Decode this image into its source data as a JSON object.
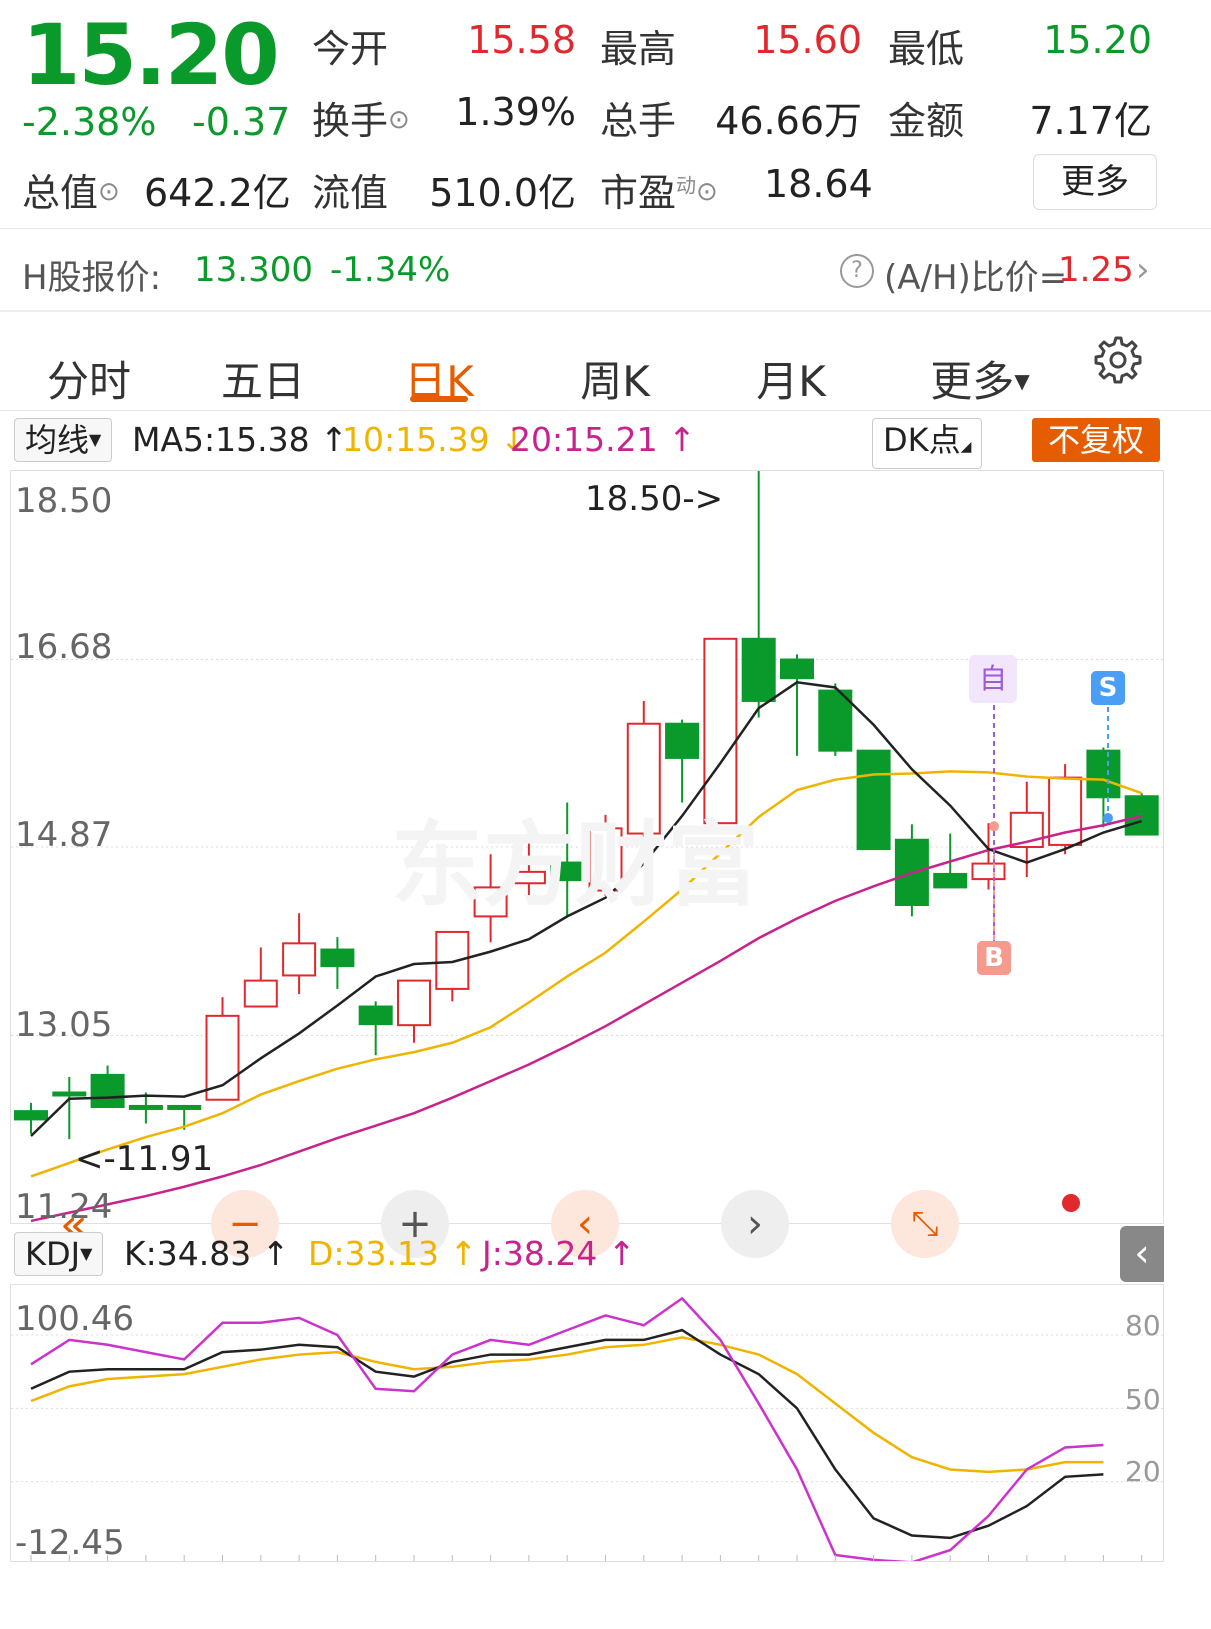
{
  "quote": {
    "price": "15.20",
    "change_pct": "-2.38%",
    "change": "-0.37",
    "rows": [
      [
        {
          "label": "今开",
          "value": "15.58",
          "color": "red"
        },
        {
          "label": "最高",
          "value": "15.60",
          "color": "red"
        },
        {
          "label": "最低",
          "value": "15.20",
          "color": "green"
        }
      ],
      [
        {
          "label": "换手",
          "value": "1.39%",
          "color": "dark"
        },
        {
          "label": "总手",
          "value": "46.66万",
          "color": "dark"
        },
        {
          "label": "金额",
          "value": "7.17亿",
          "color": "dark"
        }
      ]
    ],
    "total_value_label": "总值",
    "total_value": "642.2亿",
    "float_value_label": "流值",
    "float_value": "510.0亿",
    "pe_label": "市盈",
    "pe_superscript": "动",
    "pe_value": "18.64",
    "more_button": "更多"
  },
  "hshare": {
    "label": "H股报价:",
    "price": "13.300",
    "change_pct": "-1.34%",
    "ratio_label": "(A/H)比价=",
    "ratio_value": "1.25"
  },
  "tabs": [
    {
      "label": "分时",
      "active": false
    },
    {
      "label": "五日",
      "active": false
    },
    {
      "label": "日K",
      "active": true
    },
    {
      "label": "周K",
      "active": false
    },
    {
      "label": "月K",
      "active": false
    },
    {
      "label": "更多",
      "active": false
    }
  ],
  "ma_legend": {
    "dropdown": "均线",
    "ma5": "MA5:15.38",
    "ma10": "10:15.39",
    "ma20": "20:15.21",
    "dk_button": "DK点",
    "adjust_button": "不复权"
  },
  "price_chart": {
    "y_labels": [
      "18.50",
      "16.68",
      "14.87",
      "13.05",
      "11.24"
    ],
    "high_annotation": "18.50->",
    "low_annotation": "<-11.91",
    "watermark": "东方财富",
    "marker_self": "自",
    "marker_buy": "B",
    "marker_sell": "S"
  },
  "kdj_legend": {
    "dropdown": "KDJ",
    "k": "K:34.83",
    "d": "D:33.13",
    "j": "J:38.24"
  },
  "kdj_chart": {
    "y_labels_left": [
      "100.46",
      "-12.45"
    ],
    "y_labels_right": [
      "80",
      "50",
      "20"
    ]
  },
  "colors": {
    "up": "#e0282e",
    "down": "#0a9a2c",
    "ma5": "#222222",
    "ma10": "#f0b400",
    "ma20": "#c8238c",
    "accent": "#e65c00"
  },
  "chart_data": {
    "type": "candlestick",
    "ylim": [
      11.24,
      18.5
    ],
    "candles": [
      {
        "o": 12.32,
        "c": 12.24,
        "h": 12.4,
        "l": 12.1
      },
      {
        "o": 12.5,
        "c": 12.48,
        "h": 12.65,
        "l": 12.05
      },
      {
        "o": 12.67,
        "c": 12.36,
        "h": 12.76,
        "l": 12.36
      },
      {
        "o": 12.37,
        "c": 12.35,
        "h": 12.5,
        "l": 12.2
      },
      {
        "o": 12.37,
        "c": 12.35,
        "h": 12.38,
        "l": 12.14
      },
      {
        "o": 12.43,
        "c": 13.24,
        "h": 13.42,
        "l": 12.43
      },
      {
        "o": 13.33,
        "c": 13.58,
        "h": 13.9,
        "l": 13.33
      },
      {
        "o": 13.63,
        "c": 13.94,
        "h": 14.23,
        "l": 13.45
      },
      {
        "o": 13.88,
        "c": 13.72,
        "h": 14.0,
        "l": 13.5
      },
      {
        "o": 13.33,
        "c": 13.16,
        "h": 13.38,
        "l": 12.86
      },
      {
        "o": 13.15,
        "c": 13.58,
        "h": 13.58,
        "l": 12.98
      },
      {
        "o": 13.5,
        "c": 14.05,
        "h": 14.05,
        "l": 13.38
      },
      {
        "o": 14.2,
        "c": 14.48,
        "h": 14.8,
        "l": 13.95
      },
      {
        "o": 14.52,
        "c": 14.63,
        "h": 14.95,
        "l": 14.34
      },
      {
        "o": 14.72,
        "c": 14.55,
        "h": 15.3,
        "l": 14.2
      },
      {
        "o": 14.45,
        "c": 15.05,
        "h": 15.18,
        "l": 14.4
      },
      {
        "o": 15.0,
        "c": 16.06,
        "h": 16.28,
        "l": 14.8
      },
      {
        "o": 16.06,
        "c": 15.73,
        "h": 16.1,
        "l": 15.3
      },
      {
        "o": 15.1,
        "c": 16.88,
        "h": 16.88,
        "l": 15.1
      },
      {
        "o": 16.88,
        "c": 16.28,
        "h": 18.5,
        "l": 16.12
      },
      {
        "o": 16.68,
        "c": 16.5,
        "h": 16.73,
        "l": 15.75
      },
      {
        "o": 16.38,
        "c": 15.8,
        "h": 16.45,
        "l": 15.75
      },
      {
        "o": 15.8,
        "c": 14.85,
        "h": 15.8,
        "l": 14.85
      },
      {
        "o": 14.94,
        "c": 14.31,
        "h": 15.09,
        "l": 14.2
      },
      {
        "o": 14.61,
        "c": 14.48,
        "h": 15.0,
        "l": 14.48
      },
      {
        "o": 14.56,
        "c": 14.71,
        "h": 15.1,
        "l": 14.46
      },
      {
        "o": 14.87,
        "c": 15.2,
        "h": 15.5,
        "l": 14.58
      },
      {
        "o": 14.89,
        "c": 15.54,
        "h": 15.67,
        "l": 14.8
      },
      {
        "o": 15.8,
        "c": 15.35,
        "h": 15.83,
        "l": 15.06
      },
      {
        "o": 15.36,
        "c": 14.99,
        "h": 15.39,
        "l": 14.99
      }
    ],
    "ma5": [
      12.08,
      12.44,
      12.45,
      12.47,
      12.46,
      12.57,
      12.83,
      13.07,
      13.34,
      13.62,
      13.74,
      13.76,
      13.86,
      13.98,
      14.2,
      14.38,
      14.71,
      15.17,
      15.68,
      16.21,
      16.46,
      16.41,
      16.05,
      15.62,
      15.27,
      14.85,
      14.72,
      14.85,
      15.01,
      15.12
    ],
    "ma10": [
      11.69,
      11.82,
      11.95,
      12.07,
      12.17,
      12.3,
      12.48,
      12.61,
      12.73,
      12.82,
      12.89,
      12.98,
      13.13,
      13.37,
      13.62,
      13.85,
      14.15,
      14.46,
      14.81,
      15.16,
      15.42,
      15.52,
      15.57,
      15.58,
      15.6,
      15.59,
      15.55,
      15.53,
      15.52,
      15.39
    ],
    "ma20": [
      11.26,
      11.34,
      11.42,
      11.5,
      11.59,
      11.69,
      11.8,
      11.93,
      12.06,
      12.18,
      12.3,
      12.45,
      12.61,
      12.77,
      12.95,
      13.14,
      13.35,
      13.56,
      13.77,
      13.99,
      14.18,
      14.35,
      14.49,
      14.62,
      14.73,
      14.84,
      14.92,
      15.01,
      15.08,
      15.17
    ],
    "kdj": {
      "ylim": [
        -12.45,
        100.46
      ],
      "k": [
        58,
        65,
        66,
        66,
        66,
        73,
        74,
        76,
        75,
        65,
        63,
        69,
        72,
        72,
        75,
        78,
        78,
        82,
        72,
        64,
        50,
        25,
        5,
        -2,
        -3,
        2,
        10,
        22,
        23
      ],
      "d": [
        53,
        59,
        62,
        63,
        64,
        67,
        70,
        72,
        73,
        69,
        66,
        67,
        69,
        70,
        72,
        75,
        76,
        79,
        76,
        72,
        64,
        52,
        40,
        30,
        25,
        24,
        25,
        28,
        28
      ],
      "j": [
        68,
        78,
        76,
        73,
        70,
        85,
        85,
        87,
        80,
        58,
        57,
        72,
        78,
        76,
        82,
        88,
        84,
        95,
        78,
        52,
        25,
        -10,
        -12,
        -13,
        -8,
        6,
        25,
        34,
        35
      ]
    }
  }
}
